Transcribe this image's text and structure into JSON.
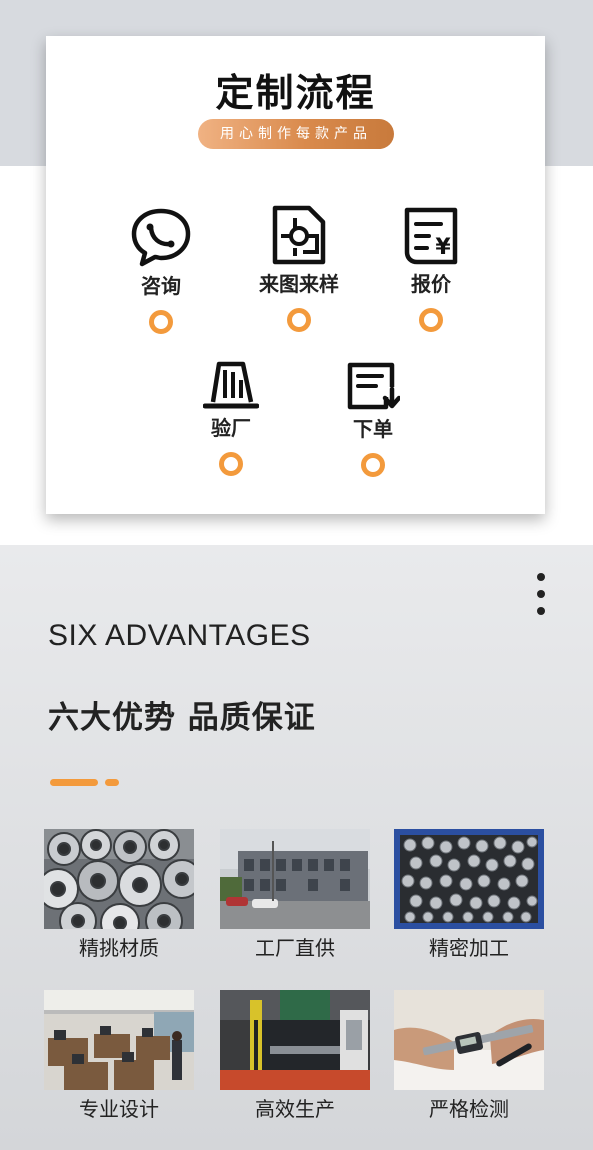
{
  "process": {
    "title": "定制流程",
    "subtitle": "用心制作每款产品",
    "steps": [
      {
        "label": "咨询",
        "icon": "chat-bubble-icon"
      },
      {
        "label": "来图来样",
        "icon": "drawing-document-icon"
      },
      {
        "label": "报价",
        "icon": "price-quote-icon"
      },
      {
        "label": "验厂",
        "icon": "factory-inspection-icon"
      },
      {
        "label": "下单",
        "icon": "order-download-icon"
      }
    ]
  },
  "advantages": {
    "heading_en": "SIX ADVANTAGES",
    "heading_cn": "六大优势 品质保证",
    "accent_color": "#f39a3c",
    "items": [
      {
        "label": "精挑材质",
        "image": "steel-coils-photo"
      },
      {
        "label": "工厂直供",
        "image": "factory-building-photo"
      },
      {
        "label": "精密加工",
        "image": "washers-bin-photo"
      },
      {
        "label": "专业设计",
        "image": "design-office-photo"
      },
      {
        "label": "高效生产",
        "image": "production-machine-photo"
      },
      {
        "label": "严格检测",
        "image": "caliper-measure-photo"
      }
    ]
  }
}
